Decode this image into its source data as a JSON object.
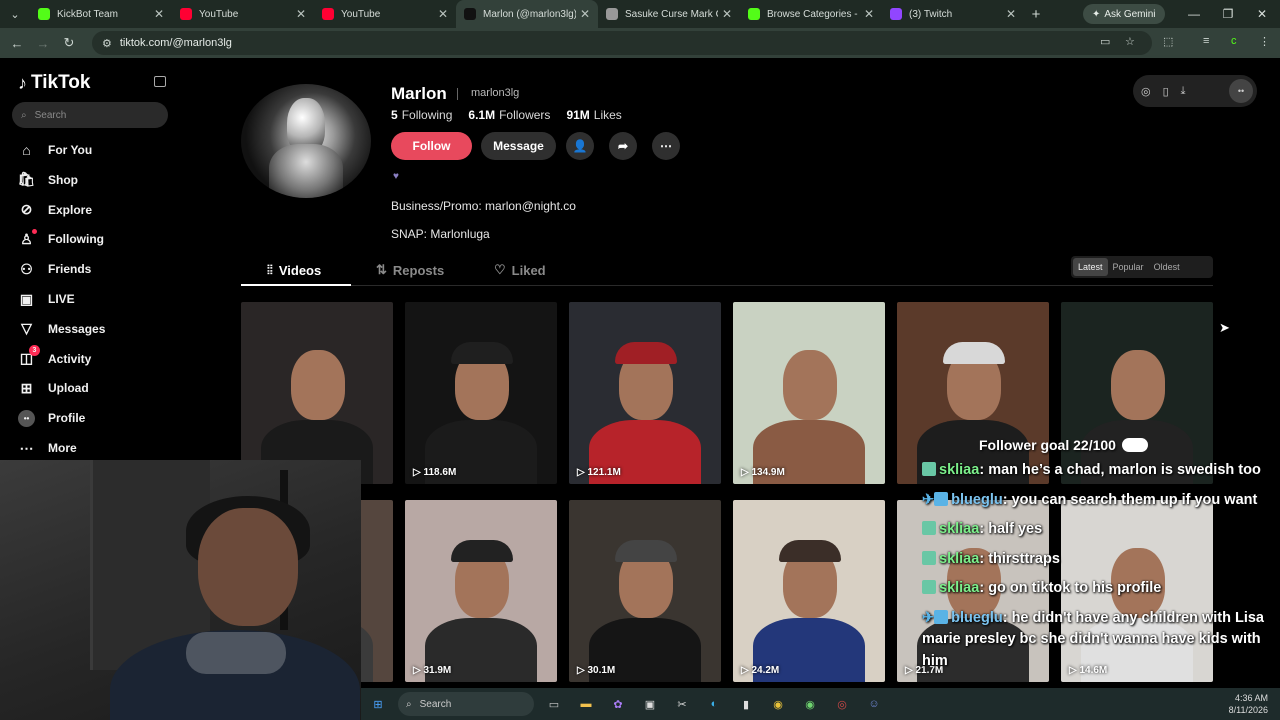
{
  "browser": {
    "tabs": [
      {
        "title": "KickBot Team",
        "color": "#53fc18"
      },
      {
        "title": "YouTube",
        "color": "#ff0033"
      },
      {
        "title": "YouTube",
        "color": "#ff0033"
      },
      {
        "title": "Marlon (@marlon3lg)",
        "color": "#111111"
      },
      {
        "title": "Sasuke Curse Mark C",
        "color": "#999999"
      },
      {
        "title": "Browse Categories - K",
        "color": "#53fc18"
      },
      {
        "title": "(3) Twitch",
        "color": "#9146ff"
      }
    ],
    "new_tab": "+",
    "ask_gemini": "Ask Gemini",
    "url": "tiktok.com/@marlon3lg"
  },
  "tiktok": {
    "logo": "TikTok",
    "search_placeholder": "Search",
    "nav": [
      {
        "label": "For You",
        "icon": "home-icon"
      },
      {
        "label": "Shop",
        "icon": "shop-icon"
      },
      {
        "label": "Explore",
        "icon": "compass-icon"
      },
      {
        "label": "Following",
        "icon": "following-icon"
      },
      {
        "label": "Friends",
        "icon": "friends-icon"
      },
      {
        "label": "LIVE",
        "icon": "live-icon"
      },
      {
        "label": "Messages",
        "icon": "messages-icon"
      },
      {
        "label": "Activity",
        "icon": "activity-icon"
      },
      {
        "label": "Upload",
        "icon": "upload-icon"
      },
      {
        "label": "Profile",
        "icon": "profile-icon"
      },
      {
        "label": "More",
        "icon": "more-icon"
      }
    ],
    "activity_badge": "3"
  },
  "profile": {
    "name": "Marlon",
    "username": "marlon3lg",
    "following_count": "5",
    "following_label": "Following",
    "followers_count": "6.1M",
    "followers_label": "Followers",
    "likes_count": "91M",
    "likes_label": "Likes",
    "follow_label": "Follow",
    "message_label": "Message",
    "bio_line1": "Business/Promo: marlon@night.co",
    "bio_line2": "SNAP: Marlonluga",
    "tabs": [
      "Videos",
      "Reposts",
      "Liked"
    ],
    "sort": [
      "Latest",
      "Popular",
      "Oldest"
    ]
  },
  "videos": [
    {
      "views": "",
      "bg": "#2a2626",
      "shirt": "#1a1a1a",
      "cap": ""
    },
    {
      "views": "118.6M",
      "bg": "#141414",
      "shirt": "#1b1b1b",
      "cap": "#1f1f1f"
    },
    {
      "views": "121.1M",
      "bg": "#2a2c32",
      "shirt": "#b7232a",
      "cap": "#a01f25"
    },
    {
      "views": "134.9M",
      "bg": "#c9d2c2",
      "shirt": "#8a5b44",
      "cap": ""
    },
    {
      "views": "",
      "bg": "#5b3a2a",
      "shirt": "#1d1d1d",
      "cap": "#d8d8d8"
    },
    {
      "views": "",
      "bg": "#1b2420",
      "shirt": "#222",
      "cap": ""
    },
    {
      "views": "",
      "bg": "#55463e",
      "shirt": "#3b3b3b",
      "cap": ""
    },
    {
      "views": "31.9M",
      "bg": "#b8a8a4",
      "shirt": "#2a2a2a",
      "cap": "#222"
    },
    {
      "views": "30.1M",
      "bg": "#3a3530",
      "shirt": "#151515",
      "cap": "#444"
    },
    {
      "views": "24.2M",
      "bg": "#d8d0c4",
      "shirt": "#23377a",
      "cap": "#3b2e28"
    },
    {
      "views": "21.7M",
      "bg": "#c8c3bd",
      "shirt": "#2c2c2c",
      "cap": ""
    },
    {
      "views": "14.6M",
      "bg": "#d8d6d2",
      "shirt": "#e0e0e0",
      "cap": ""
    }
  ],
  "overlay": {
    "follower_goal": "Follower goal 22/100",
    "chat": [
      {
        "user": "skliaa",
        "text": "man he’s a chad, marlon is swedish too",
        "color": "green"
      },
      {
        "user": "blueglu",
        "text": "you can search them up if you want",
        "color": "blue"
      },
      {
        "user": "skliaa",
        "text": "half yes",
        "color": "green"
      },
      {
        "user": "skliaa",
        "text": "thirsttraps",
        "color": "green"
      },
      {
        "user": "skliaa",
        "text": "go on tiktok to his profile",
        "color": "green"
      },
      {
        "user": "blueglu",
        "text": "he didn't have any children with Lisa marie presley bc she didn't wanna have kids with him",
        "color": "blue"
      }
    ]
  },
  "taskbar": {
    "search_placeholder": "Search",
    "time": "4:36 AM",
    "date": "8/11/2026"
  }
}
